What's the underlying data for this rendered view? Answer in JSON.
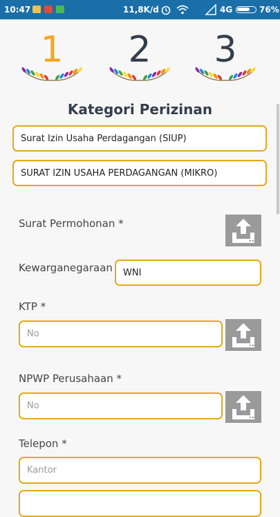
{
  "status_bar": {
    "time": "10:47",
    "speed": "11,8K/d",
    "network": "4G",
    "battery": "76%",
    "battery_level": 0.76,
    "icons": [
      "gallery-icon",
      "gmail-icon",
      "chat-app-icon",
      "alarm-icon",
      "wifi-icon",
      "signal-icon"
    ]
  },
  "steps": [
    {
      "number": "1",
      "color": "#f5a623"
    },
    {
      "number": "2",
      "color": "#343f4b"
    },
    {
      "number": "3",
      "color": "#343f4b"
    }
  ],
  "form": {
    "title": "Kategori Perizinan",
    "category_value": "Surat Izin Usaha Perdagangan (SIUP)",
    "subcategory_value": "SURAT IZIN USAHA PERDAGANGAN (MIKRO)",
    "surat_permohonan_label": "Surat Permohonan *",
    "kewarganegaraan_label": "Kewarganegaraan",
    "kewarganegaraan_value": "WNI",
    "ktp_label": "KTP *",
    "ktp_placeholder": "No",
    "npwp_label": "NPWP Perusahaan *",
    "npwp_placeholder": "No",
    "telepon_label": "Telepon *",
    "telepon_placeholder": "Kantor"
  },
  "colors": {
    "accent": "#e6a817",
    "status_bar": "#1a6fa8",
    "upload_button": "#9a9a9a"
  }
}
